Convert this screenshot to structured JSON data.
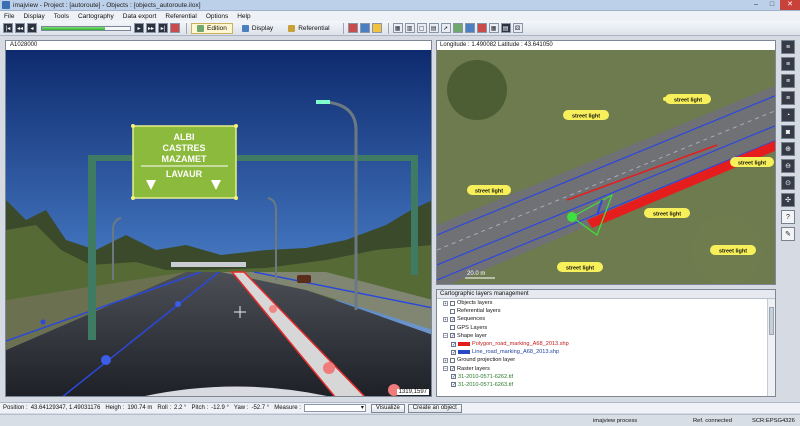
{
  "window": {
    "title": "imajview - Project : [autoroute] - Objects : [objects_autoroute.ilox]",
    "minimize": "–",
    "maximize": "□",
    "close": "✕"
  },
  "menu": [
    "File",
    "Display",
    "Tools",
    "Cartography",
    "Data export",
    "Referential",
    "Options",
    "Help"
  ],
  "toolbar": {
    "progress_fraction": 0.72,
    "modes": [
      {
        "label": "Edition",
        "active": true,
        "color": "#6fa86c"
      },
      {
        "label": "Display",
        "active": false,
        "color": "#4a7fc1"
      },
      {
        "label": "Referential",
        "active": false,
        "color": "#c9a13a"
      }
    ],
    "nav_left_icons": [
      "first-frame-icon",
      "previous-frame-icon",
      "play-backward-icon"
    ],
    "nav_right_icons": [
      "play-icon",
      "next-frame-icon",
      "last-frame-icon",
      "record-icon"
    ],
    "right_icons": [
      "layout-grid-icon",
      "layout-split-icon",
      "layout-single-icon",
      "camera-icon",
      "target-icon",
      "dice-icon",
      "stack-icon",
      "arrow-icon",
      "globe-icon",
      "grid-icon",
      "layers-icon"
    ]
  },
  "video": {
    "frame_label": "A1028000",
    "coords": "1319,1597",
    "sign_lines": [
      "ALBI",
      "CASTRES",
      "MAZAMET",
      "LAVAUR"
    ]
  },
  "map": {
    "header": "Longitude : 1.490082 Latitude : 43.641050",
    "labels": [
      "street light",
      "street light",
      "street light",
      "street light",
      "street light",
      "street light",
      "street light"
    ],
    "scale": "20.0 m"
  },
  "layers": {
    "header": "Cartographic layers management",
    "rows": [
      {
        "label": "Objects layers",
        "level": 0,
        "expander": "+",
        "checked": false,
        "style": ""
      },
      {
        "label": "Referential layers",
        "level": 0,
        "expander": "",
        "checked": false,
        "style": ""
      },
      {
        "label": "Sequences",
        "level": 0,
        "expander": "+",
        "checked": true,
        "style": ""
      },
      {
        "label": "GPS Layers",
        "level": 0,
        "expander": "",
        "checked": false,
        "style": ""
      },
      {
        "label": "Shape layer",
        "level": 0,
        "expander": "−",
        "checked": true,
        "style": ""
      },
      {
        "label": "Polygon_road_marking_A68_2013.shp",
        "level": 1,
        "expander": "",
        "checked": true,
        "style": "red",
        "swatch": "#e21b1b"
      },
      {
        "label": "Line_road_marking_A68_2013.shp",
        "level": 1,
        "expander": "",
        "checked": true,
        "style": "blue",
        "swatch": "#2a47c7"
      },
      {
        "label": "Ground projection layer",
        "level": 0,
        "expander": "+",
        "checked": false,
        "style": ""
      },
      {
        "label": "Raster layers",
        "level": 0,
        "expander": "−",
        "checked": true,
        "style": ""
      },
      {
        "label": "31-2010-0571-6262.tif",
        "level": 1,
        "expander": "",
        "checked": true,
        "style": "green"
      },
      {
        "label": "31-2010-0571-6263.tif",
        "level": 1,
        "expander": "",
        "checked": true,
        "style": "green"
      }
    ]
  },
  "right_tools": [
    "slider-icon",
    "slider-icon",
    "slider-icon",
    "slider-icon",
    "gauge-icon",
    "camera-icon",
    "zoom-in-icon",
    "zoom-out-icon",
    "zoom-fit-icon",
    "compass-icon",
    "help-icon",
    "edit-icon"
  ],
  "bottom": {
    "position_label": "Position :",
    "position_value": "43.64129347, 1.49031176",
    "heigh_label": "Heigh :",
    "heigh_value": "190.74 m",
    "roll_label": "Roll :",
    "roll_value": "2.2 °",
    "pitch_label": "Pitch :",
    "pitch_value": "-12.9 °",
    "yaw_label": "Yaw :",
    "yaw_value": "-52.7 °",
    "measure_label": "Measure :",
    "visualize": "Visualize",
    "create_object": "Create an object"
  },
  "status": {
    "process": "imajview process",
    "ref": "Ref. connected",
    "scr": "SCR:EPSG4326"
  }
}
